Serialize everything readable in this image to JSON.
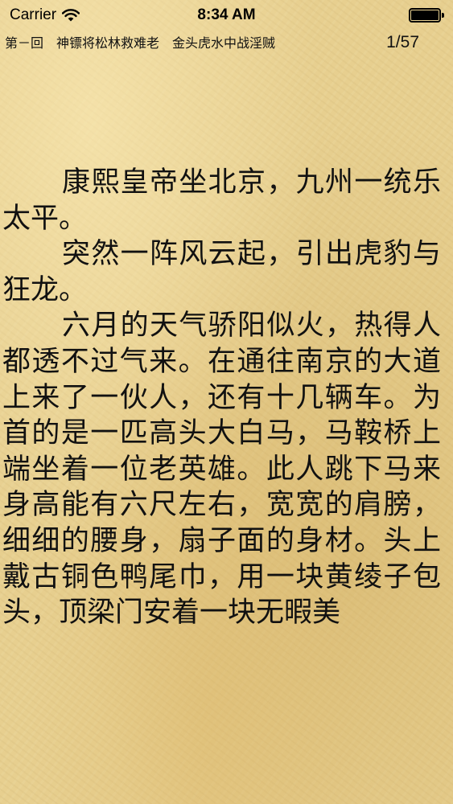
{
  "status_bar": {
    "carrier": "Carrier",
    "time": "8:34 AM",
    "icons": [
      "wifi-icon",
      "battery-icon"
    ]
  },
  "chapter": {
    "title": "第－回　神镖将松林救难老　金头虎水中战淫贼",
    "page": "1/57"
  },
  "content": {
    "paragraphs": [
      "康熙皇帝坐北京，九州一统乐太平。",
      "突然一阵风云起，引出虎豹与狂龙。",
      "六月的天气骄阳似火，热得人都透不过气来。在通往南京的大道上来了一伙人，还有十几辆车。为首的是一匹高头大白马，马鞍桥上端坐着一位老英雄。此人跳下马来身高能有六尺左右，宽宽的肩膀，细细的腰身，扇子面的身材。头上戴古铜色鸭尾巾，用一块黄绫子包头，顶梁门安着一块无暇美"
    ]
  },
  "colors": {
    "paper": "#e7cf8f",
    "text": "#111111"
  }
}
